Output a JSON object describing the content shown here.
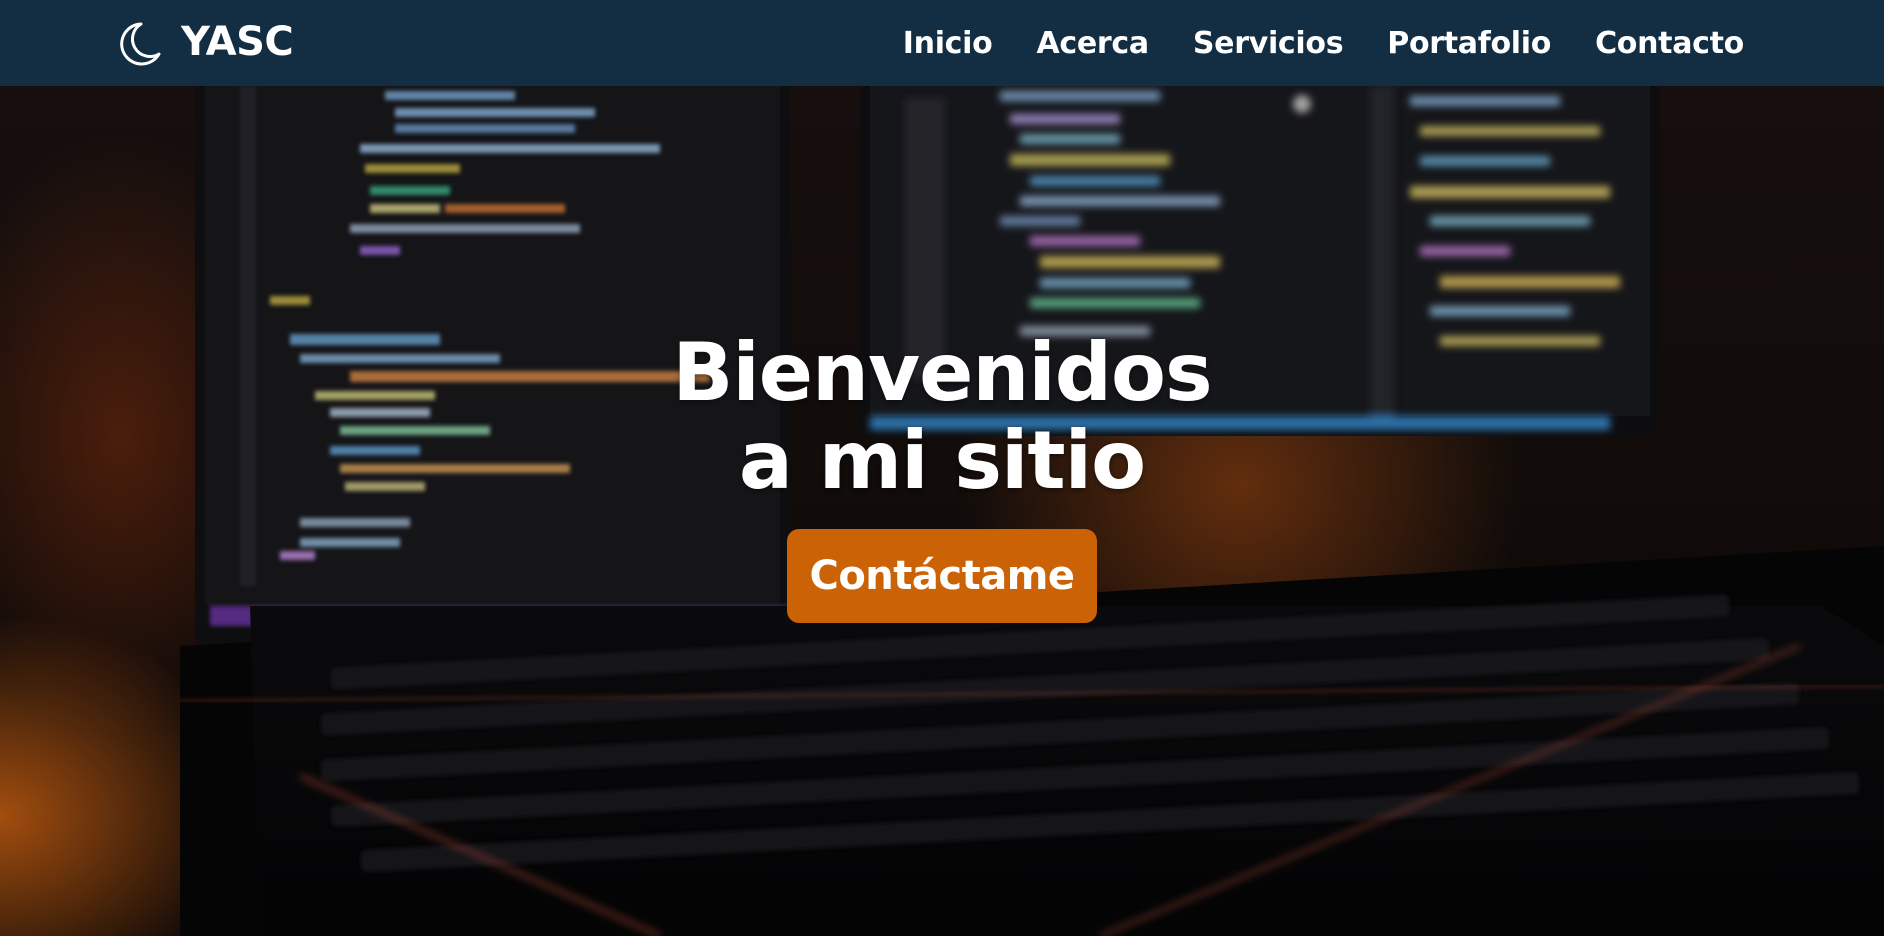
{
  "header": {
    "brand": "YASC",
    "brand_icon": "moon-icon",
    "background_color": "#132d42",
    "nav": [
      {
        "label": "Inicio"
      },
      {
        "label": "Acerca"
      },
      {
        "label": "Servicios"
      },
      {
        "label": "Portafolio"
      },
      {
        "label": "Contacto"
      }
    ]
  },
  "hero": {
    "title_line1": "Bienvenidos",
    "title_line2": "a mi sitio",
    "cta_label": "Contáctame",
    "cta_color": "#cc6206",
    "background_image": "blurred-code-monitors-keyboard"
  }
}
